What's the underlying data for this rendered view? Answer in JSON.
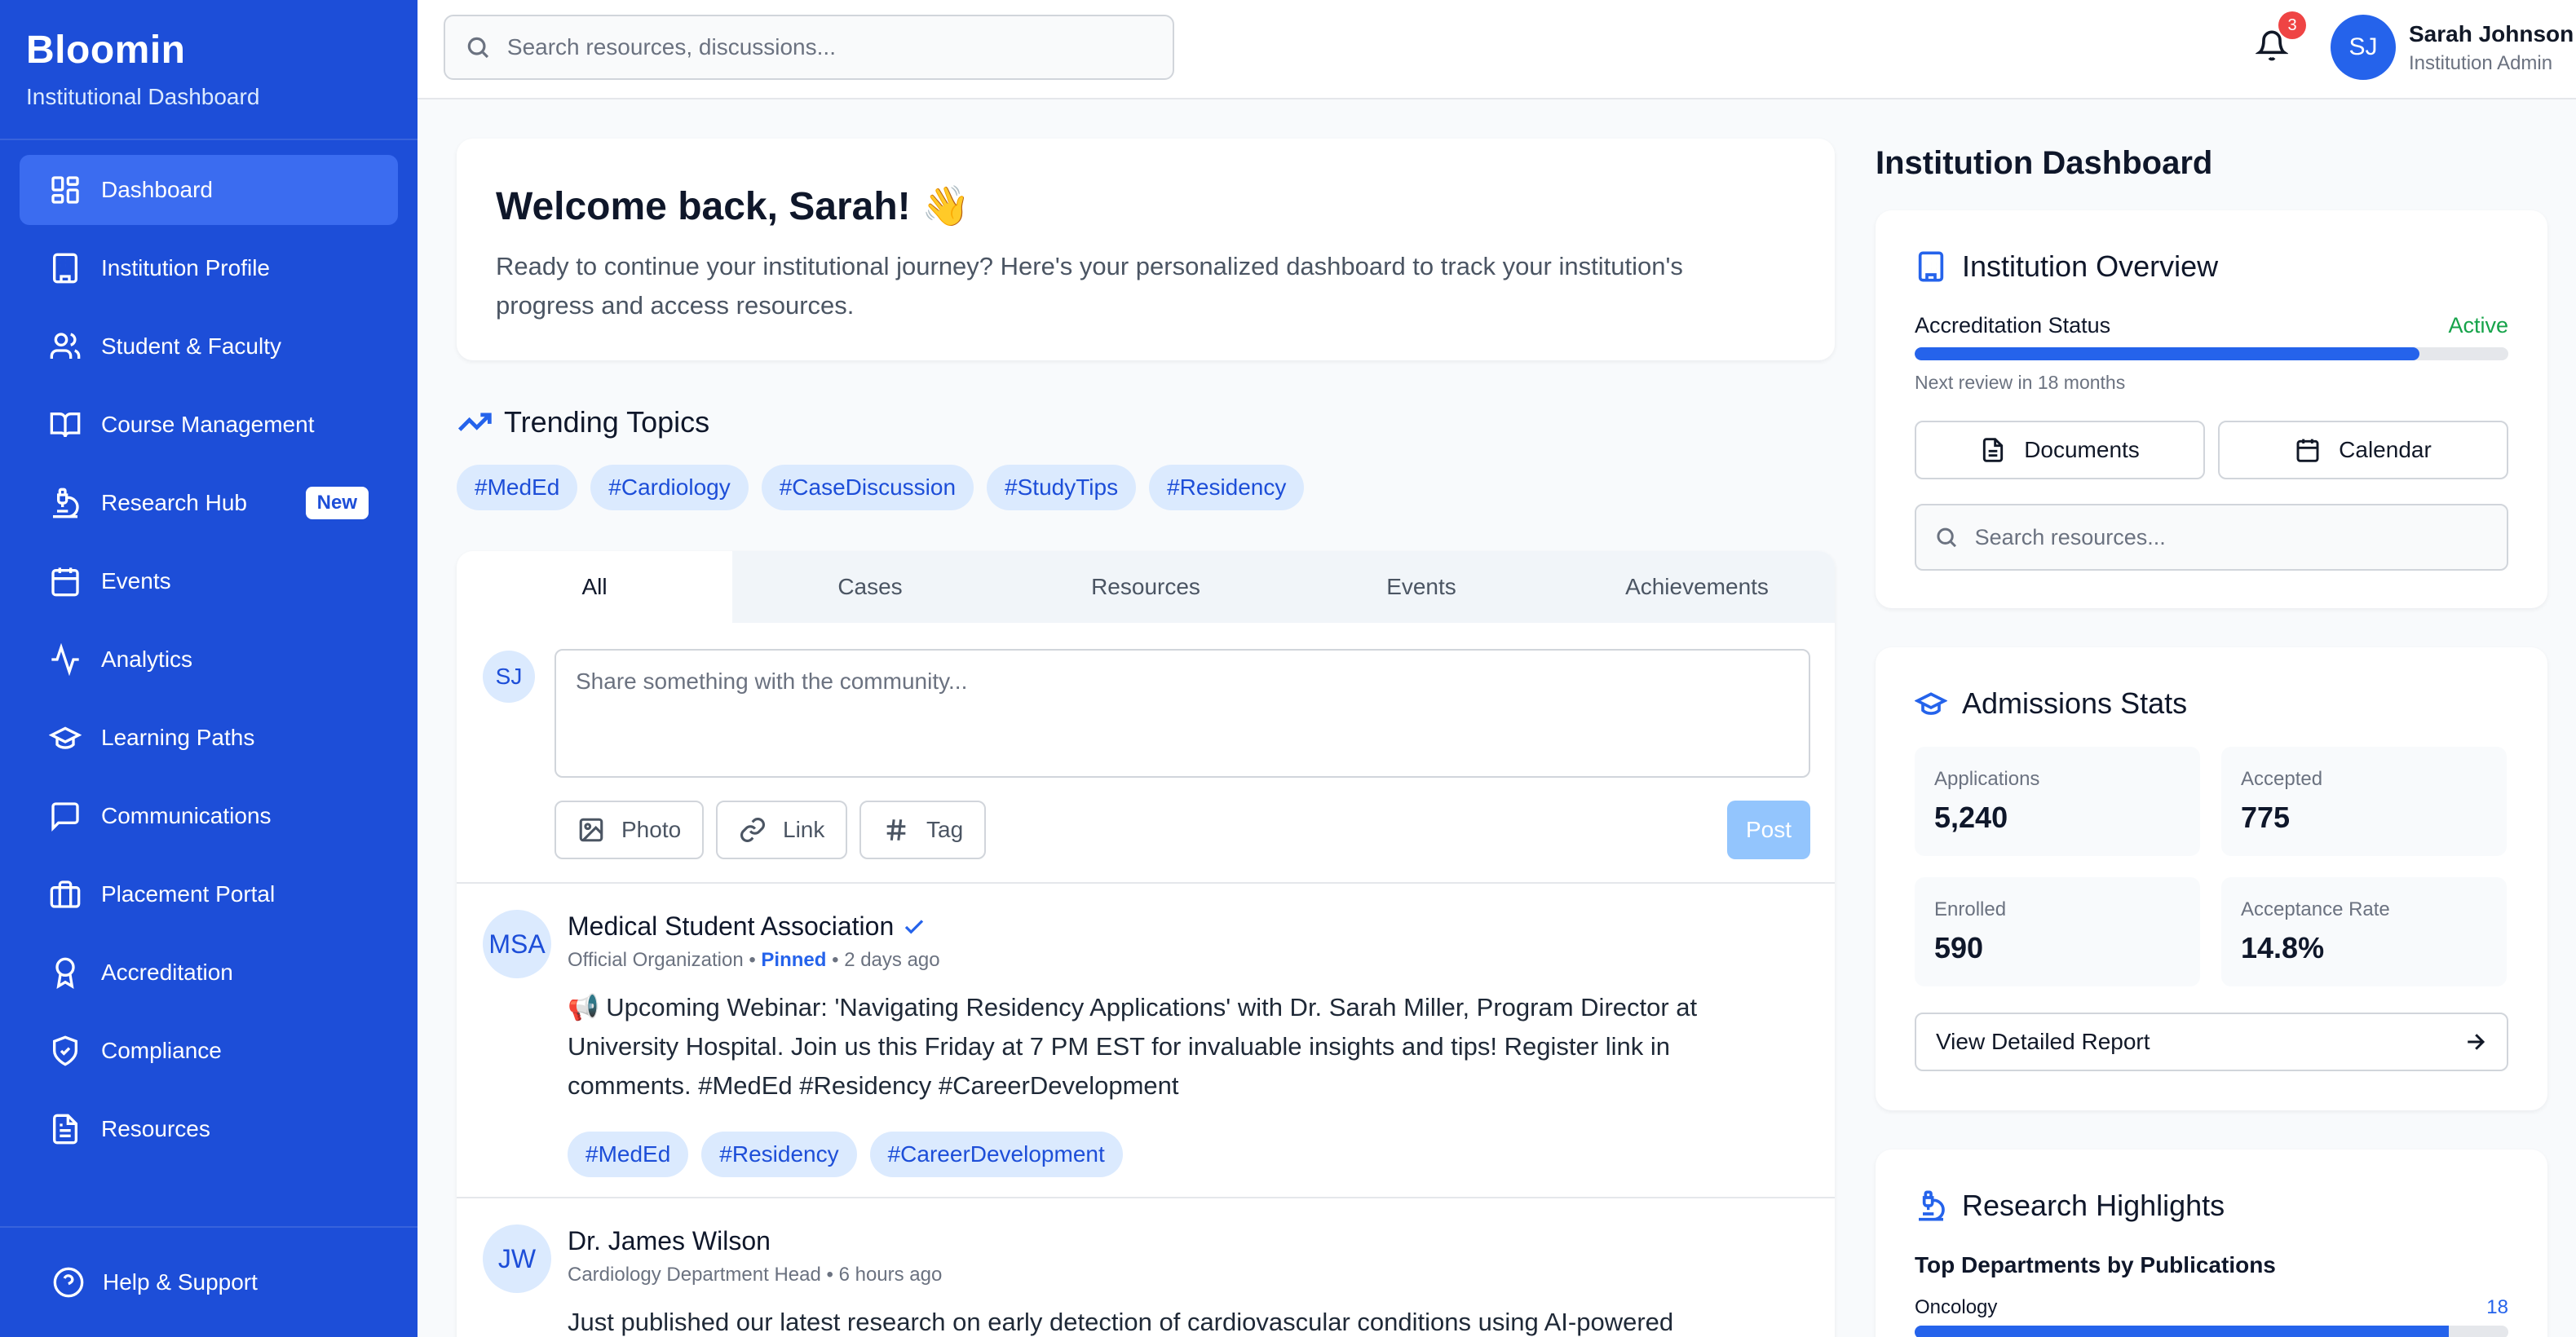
{
  "sidebar": {
    "brand": "Bloomin",
    "subtitle": "Institutional Dashboard",
    "items": [
      {
        "label": "Dashboard",
        "icon": "grid-icon",
        "active": true
      },
      {
        "label": "Institution Profile",
        "icon": "building-icon"
      },
      {
        "label": "Student & Faculty",
        "icon": "users-icon"
      },
      {
        "label": "Course Management",
        "icon": "book-icon"
      },
      {
        "label": "Research Hub",
        "icon": "microscope-icon",
        "badge": "New"
      },
      {
        "label": "Events",
        "icon": "calendar-icon"
      },
      {
        "label": "Analytics",
        "icon": "activity-icon"
      },
      {
        "label": "Learning Paths",
        "icon": "graduation-cap-icon"
      },
      {
        "label": "Communications",
        "icon": "message-icon"
      },
      {
        "label": "Placement Portal",
        "icon": "briefcase-icon"
      },
      {
        "label": "Accreditation",
        "icon": "award-icon"
      },
      {
        "label": "Compliance",
        "icon": "shield-icon"
      },
      {
        "label": "Resources",
        "icon": "file-icon"
      }
    ],
    "help": "Help & Support"
  },
  "topbar": {
    "search_placeholder": "Search resources, discussions...",
    "notification_count": "3",
    "user_initials": "SJ",
    "user_name": "Sarah Johnson",
    "user_role": "Institution Admin"
  },
  "welcome": {
    "title": "Welcome back, Sarah! 👋",
    "text": "Ready to continue your institutional journey? Here's your personalized dashboard to track your institution's progress and access resources."
  },
  "trending": {
    "title": "Trending Topics",
    "tags": [
      "#MedEd",
      "#Cardiology",
      "#CaseDiscussion",
      "#StudyTips",
      "#Residency"
    ]
  },
  "feed": {
    "tabs": [
      "All",
      "Cases",
      "Resources",
      "Events",
      "Achievements"
    ],
    "composer": {
      "initials": "SJ",
      "placeholder": "Share something with the community...",
      "photo": "Photo",
      "link": "Link",
      "tag": "Tag",
      "post": "Post"
    },
    "posts": [
      {
        "initials": "MSA",
        "author": "Medical Student Association",
        "role": "Official Organization",
        "pinned": "Pinned",
        "time": "2 days ago",
        "body": "📢 Upcoming Webinar: 'Navigating Residency Applications' with Dr. Sarah Miller, Program Director at University Hospital. Join us this Friday at 7 PM EST for invaluable insights and tips! Register link in comments. #MedEd #Residency #CareerDevelopment",
        "tags": [
          "#MedEd",
          "#Residency",
          "#CareerDevelopment"
        ]
      },
      {
        "initials": "JW",
        "author": "Dr. James Wilson",
        "role": "Cardiology Department Head",
        "time": "6 hours ago",
        "body": "Just published our latest research on early detection of cardiovascular conditions using AI-powered"
      }
    ]
  },
  "right": {
    "title": "Institution Dashboard",
    "overview": {
      "title": "Institution Overview",
      "label": "Accreditation Status",
      "status": "Active",
      "progress": 0.85,
      "next_review": "Next review in 18 months",
      "documents": "Documents",
      "calendar": "Calendar",
      "search_placeholder": "Search resources..."
    },
    "admissions": {
      "title": "Admissions Stats",
      "stats": [
        {
          "label": "Applications",
          "value": "5,240"
        },
        {
          "label": "Accepted",
          "value": "775"
        },
        {
          "label": "Enrolled",
          "value": "590"
        },
        {
          "label": "Acceptance Rate",
          "value": "14.8%"
        }
      ],
      "report": "View Detailed Report"
    },
    "research": {
      "title": "Research Highlights",
      "subtitle": "Top Departments by Publications",
      "departments": [
        {
          "name": "Oncology",
          "count": "18",
          "share": 0.9
        }
      ]
    }
  },
  "colors": {
    "primary": "#1d4ed8",
    "accent": "#2563eb",
    "success": "#16a34a",
    "danger": "#ef4444"
  }
}
